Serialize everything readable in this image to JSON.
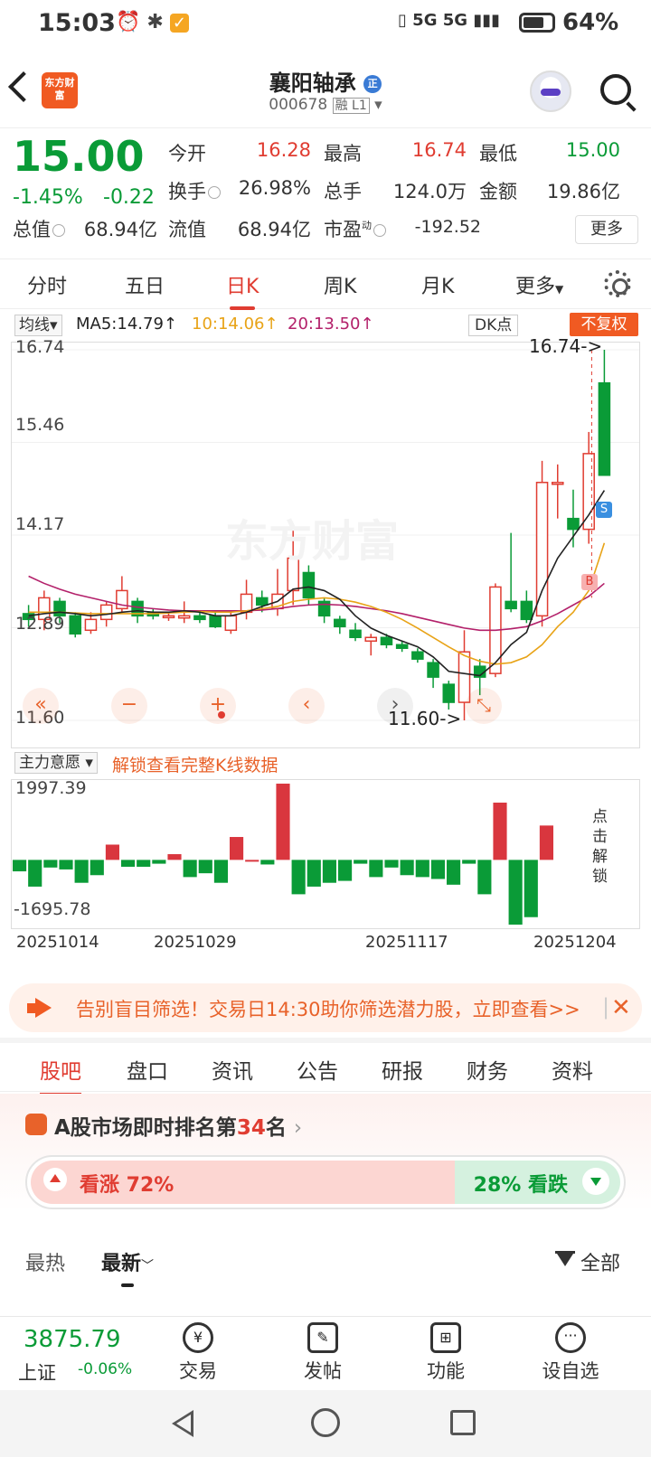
{
  "status_bar": {
    "time": "15:03",
    "network": "5G 5G",
    "battery": "64%"
  },
  "header": {
    "stock_name": "襄阳轴承",
    "stock_code": "000678",
    "code_tags": "融 L1",
    "logo_text": "东方财富"
  },
  "quote": {
    "price": "15.00",
    "change_pct": "-1.45%",
    "change": "-0.22",
    "fields": [
      {
        "label": "今开",
        "value": "16.28"
      },
      {
        "label": "最高",
        "value": "16.74"
      },
      {
        "label": "最低",
        "value": "15.00"
      },
      {
        "label": "换手",
        "value": "26.98%"
      },
      {
        "label": "总手",
        "value": "124.0万"
      },
      {
        "label": "金额",
        "value": "19.86亿"
      },
      {
        "label": "总值",
        "value": "68.94亿"
      },
      {
        "label": "流值",
        "value": "68.94亿"
      },
      {
        "label": "市盈",
        "value": "-192.52"
      }
    ],
    "pe_sup": "动",
    "more": "更多"
  },
  "period_tabs": [
    "分时",
    "五日",
    "日K",
    "周K",
    "月K",
    "更多"
  ],
  "ma_bar": {
    "selector": "均线",
    "ma5": "MA5:14.79↑",
    "ma10": "10:14.06↑",
    "ma20": "20:13.50↑",
    "dk": "DK点",
    "adjust": "不复权"
  },
  "kline": {
    "axis_labels": [
      "16.74",
      "15.46",
      "14.17",
      "12.89",
      "11.60"
    ],
    "high_marker": "16.74->",
    "low_marker": "11.60->",
    "watermark": "东方财富",
    "marker_s": "S",
    "marker_b": "B",
    "controls": [
      "«",
      "−",
      "+",
      "‹",
      "›",
      "⤡"
    ]
  },
  "sub_chart": {
    "selector": "主力意愿",
    "unlock": "解锁查看完整K线数据",
    "max": "1997.39",
    "min": "-1695.78",
    "unlock_side": "点击解锁"
  },
  "dates": [
    "20251014",
    "20251029",
    "20251117",
    "20251204"
  ],
  "banner": {
    "text": "告别盲目筛选！交易日14:30助你筛选潜力股，立即查看>>"
  },
  "section_tabs": [
    "股吧",
    "盘口",
    "资讯",
    "公告",
    "研报",
    "财务",
    "资料"
  ],
  "ranking": {
    "prefix": "A股市场即时排名第",
    "rank": "34",
    "suffix": "名",
    "up": "看涨 72%",
    "down": "28% 看跌",
    "up_fraction": 0.72
  },
  "sort": {
    "hot": "最热",
    "new": "最新",
    "all": "全部"
  },
  "bottom_nav": {
    "index_value": "3875.79",
    "index_name": "上证",
    "index_change": "-0.06%",
    "items": [
      "交易",
      "发帖",
      "功能",
      "设自选"
    ]
  },
  "chart_data": {
    "type": "candlestick",
    "ylim": [
      11.6,
      16.74
    ],
    "candles": [
      {
        "o": 13.08,
        "c": 13.0,
        "h": 13.2,
        "l": 12.9
      },
      {
        "o": 13.0,
        "c": 13.3,
        "h": 13.4,
        "l": 12.85
      },
      {
        "o": 13.25,
        "c": 13.05,
        "h": 13.3,
        "l": 12.95
      },
      {
        "o": 13.05,
        "c": 12.8,
        "h": 13.1,
        "l": 12.75
      },
      {
        "o": 12.85,
        "c": 13.0,
        "h": 13.1,
        "l": 12.8
      },
      {
        "o": 13.0,
        "c": 13.2,
        "h": 13.25,
        "l": 12.9
      },
      {
        "o": 13.15,
        "c": 13.4,
        "h": 13.6,
        "l": 13.1
      },
      {
        "o": 13.25,
        "c": 13.05,
        "h": 13.3,
        "l": 12.95
      },
      {
        "o": 13.1,
        "c": 13.05,
        "h": 13.15,
        "l": 13.0
      },
      {
        "o": 13.05,
        "c": 13.05,
        "h": 13.1,
        "l": 12.98
      },
      {
        "o": 13.02,
        "c": 13.05,
        "h": 13.25,
        "l": 12.95
      },
      {
        "o": 13.05,
        "c": 13.0,
        "h": 13.1,
        "l": 12.95
      },
      {
        "o": 13.05,
        "c": 12.9,
        "h": 13.1,
        "l": 12.88
      },
      {
        "o": 12.85,
        "c": 13.05,
        "h": 13.12,
        "l": 12.8
      },
      {
        "o": 13.1,
        "c": 13.35,
        "h": 13.55,
        "l": 13.0
      },
      {
        "o": 13.3,
        "c": 13.2,
        "h": 13.4,
        "l": 13.1
      },
      {
        "o": 13.15,
        "c": 13.35,
        "h": 13.7,
        "l": 13.05
      },
      {
        "o": 13.4,
        "c": 13.85,
        "h": 14.3,
        "l": 13.2
      },
      {
        "o": 13.65,
        "c": 13.3,
        "h": 13.75,
        "l": 13.2
      },
      {
        "o": 13.25,
        "c": 13.05,
        "h": 13.3,
        "l": 12.95
      },
      {
        "o": 13.0,
        "c": 12.9,
        "h": 13.05,
        "l": 12.8
      },
      {
        "o": 12.85,
        "c": 12.75,
        "h": 12.95,
        "l": 12.7
      },
      {
        "o": 12.7,
        "c": 12.75,
        "h": 12.8,
        "l": 12.5
      },
      {
        "o": 12.75,
        "c": 12.65,
        "h": 12.8,
        "l": 12.6
      },
      {
        "o": 12.65,
        "c": 12.6,
        "h": 12.7,
        "l": 12.55
      },
      {
        "o": 12.55,
        "c": 12.45,
        "h": 12.6,
        "l": 12.4
      },
      {
        "o": 12.4,
        "c": 12.2,
        "h": 12.45,
        "l": 12.05
      },
      {
        "o": 12.1,
        "c": 11.85,
        "h": 12.15,
        "l": 11.75
      },
      {
        "o": 11.85,
        "c": 12.55,
        "h": 12.85,
        "l": 11.6
      },
      {
        "o": 12.35,
        "c": 12.2,
        "h": 12.45,
        "l": 11.95
      },
      {
        "o": 12.25,
        "c": 13.45,
        "h": 13.5,
        "l": 12.2
      },
      {
        "o": 13.25,
        "c": 13.15,
        "h": 14.2,
        "l": 13.1
      },
      {
        "o": 13.25,
        "c": 13.0,
        "h": 13.4,
        "l": 12.95
      },
      {
        "o": 13.05,
        "c": 14.9,
        "h": 15.2,
        "l": 12.9
      },
      {
        "o": 14.9,
        "c": 14.9,
        "h": 15.15,
        "l": 14.4
      },
      {
        "o": 14.4,
        "c": 14.25,
        "h": 14.8,
        "l": 14.0
      },
      {
        "o": 14.25,
        "c": 15.3,
        "h": 15.6,
        "l": 14.05
      },
      {
        "o": 16.28,
        "c": 15.0,
        "h": 16.74,
        "l": 15.0
      }
    ],
    "ma5": [
      13.05,
      13.08,
      13.1,
      13.08,
      13.05,
      13.07,
      13.1,
      13.12,
      13.1,
      13.1,
      13.12,
      13.1,
      13.05,
      13.05,
      13.1,
      13.18,
      13.25,
      13.42,
      13.45,
      13.4,
      13.28,
      13.05,
      12.88,
      12.78,
      12.7,
      12.62,
      12.48,
      12.28,
      12.25,
      12.22,
      12.4,
      12.65,
      12.82,
      13.4,
      13.85,
      14.15,
      14.45,
      14.79
    ],
    "ma10": [
      13.1,
      13.1,
      13.1,
      13.09,
      13.08,
      13.08,
      13.08,
      13.08,
      13.08,
      13.09,
      13.1,
      13.11,
      13.1,
      13.1,
      13.12,
      13.15,
      13.18,
      13.25,
      13.28,
      13.3,
      13.28,
      13.24,
      13.18,
      13.1,
      13.0,
      12.88,
      12.75,
      12.62,
      12.5,
      12.42,
      12.38,
      12.4,
      12.48,
      12.65,
      12.9,
      13.1,
      13.4,
      14.06
    ],
    "ma20": [
      13.6,
      13.5,
      13.42,
      13.35,
      13.3,
      13.25,
      13.2,
      13.17,
      13.15,
      13.13,
      13.12,
      13.12,
      13.12,
      13.12,
      13.12,
      13.13,
      13.15,
      13.18,
      13.2,
      13.21,
      13.2,
      13.18,
      13.15,
      13.12,
      13.08,
      13.03,
      12.98,
      12.93,
      12.88,
      12.85,
      12.85,
      12.87,
      12.9,
      12.98,
      13.08,
      13.2,
      13.32,
      13.5
    ],
    "main_force": [
      -300,
      -700,
      -200,
      -250,
      -600,
      -400,
      400,
      -180,
      -180,
      -100,
      150,
      -450,
      -350,
      -600,
      600,
      0,
      -120,
      1997,
      -900,
      -700,
      -600,
      -550,
      -100,
      -450,
      -200,
      -400,
      -450,
      -500,
      -650,
      -100,
      -900,
      1500,
      -1695,
      -1500,
      900
    ]
  }
}
